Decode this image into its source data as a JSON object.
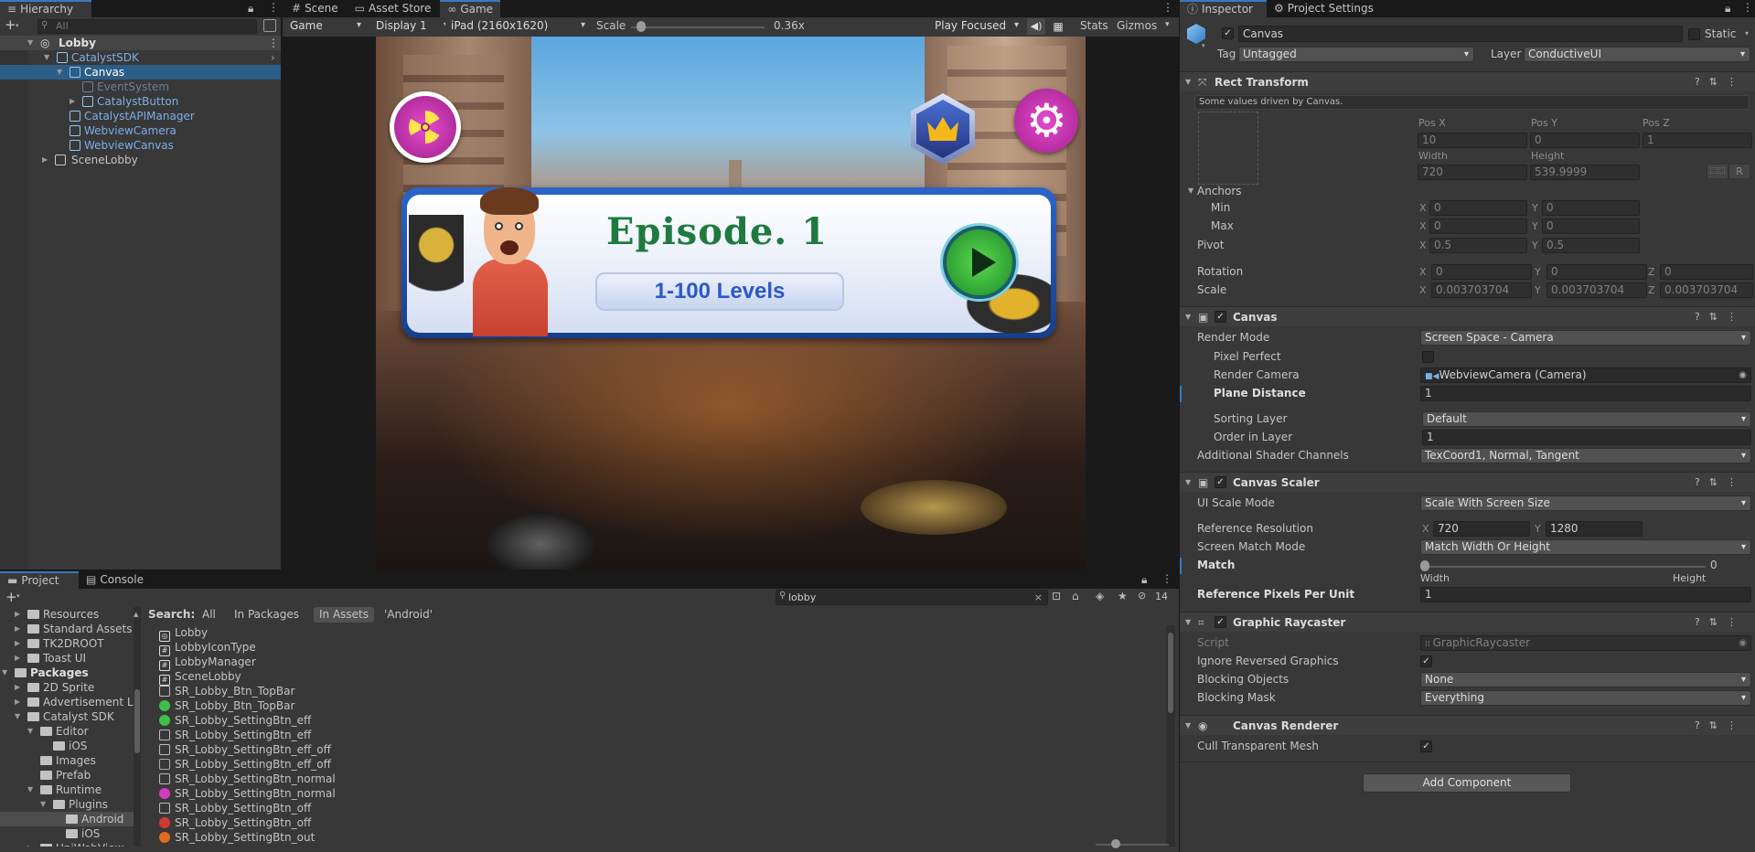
{
  "hierarchy": {
    "tab": "Hierarchy",
    "search_placeholder": "All",
    "items": [
      {
        "label": "Lobby",
        "arrow": "▼"
      },
      {
        "label": "CatalystSDK",
        "arrow": "▼"
      },
      {
        "label": "Canvas",
        "arrow": "▼"
      },
      {
        "label": "EventSystem",
        "arrow": ""
      },
      {
        "label": "CatalystButton",
        "arrow": "▶"
      },
      {
        "label": "CatalystAPIManager",
        "arrow": ""
      },
      {
        "label": "WebviewCamera",
        "arrow": ""
      },
      {
        "label": "WebviewCanvas",
        "arrow": ""
      },
      {
        "label": "SceneLobby",
        "arrow": "▶"
      }
    ]
  },
  "center_tabs": [
    {
      "label": "Scene",
      "icon": "scene-icon"
    },
    {
      "label": "Asset Store",
      "icon": "store-icon"
    },
    {
      "label": "Game",
      "icon": "game-icon"
    }
  ],
  "game_toolbar": {
    "mode": "Game",
    "display": "Display 1",
    "resolution": "iPad (2160x1620)",
    "scale_label": "Scale",
    "scale_value": "0.36x",
    "scale_fraction": 0.04,
    "play_mode": "Play Focused",
    "stats": "Stats",
    "gizmos": "Gizmos"
  },
  "game_view": {
    "episode_title": "Episode. 1",
    "levels_label": "1-100 Levels",
    "colors": {
      "title": "#1e7a3e",
      "levels": "#2b59c7",
      "accent": "#c22aa6"
    }
  },
  "inspector": {
    "tabs": [
      {
        "label": "Inspector"
      },
      {
        "label": "Project Settings"
      }
    ],
    "object_name": "Canvas",
    "static_label": "Static",
    "tag_label": "Tag",
    "tag_value": "Untagged",
    "layer_label": "Layer",
    "layer_value": "ConductiveUI",
    "rect_transform": {
      "title": "Rect Transform",
      "note": "Some values driven by Canvas.",
      "pos_x_label": "Pos X",
      "pos_y_label": "Pos Y",
      "pos_z_label": "Pos Z",
      "pos_x": "10",
      "pos_y": "0",
      "pos_z": "1",
      "width_label": "Width",
      "height_label": "Height",
      "width": "720",
      "height": "539.9999",
      "r_button": "R",
      "anchors_label": "Anchors",
      "min_label": "Min",
      "min_x": "0",
      "min_y": "0",
      "max_label": "Max",
      "max_x": "0",
      "max_y": "0",
      "pivot_label": "Pivot",
      "pivot_x": "0.5",
      "pivot_y": "0.5",
      "rotation_label": "Rotation",
      "rot_x": "0",
      "rot_y": "0",
      "rot_z": "0",
      "scale_label": "Scale",
      "scale_x": "0.003703704",
      "scale_y": "0.003703704",
      "scale_z": "0.003703704"
    },
    "canvas": {
      "title": "Canvas",
      "render_mode_label": "Render Mode",
      "render_mode": "Screen Space - Camera",
      "pixel_perfect_label": "Pixel Perfect",
      "render_camera_label": "Render Camera",
      "render_camera": "WebviewCamera (Camera)",
      "plane_distance_label": "Plane Distance",
      "plane_distance": "1",
      "sorting_layer_label": "Sorting Layer",
      "sorting_layer": "Default",
      "order_label": "Order in Layer",
      "order": "1",
      "shader_label": "Additional Shader Channels",
      "shader": "TexCoord1, Normal, Tangent"
    },
    "canvas_scaler": {
      "title": "Canvas Scaler",
      "ui_scale_label": "UI Scale Mode",
      "ui_scale": "Scale With Screen Size",
      "ref_res_label": "Reference Resolution",
      "ref_x": "720",
      "ref_y": "1280",
      "match_mode_label": "Screen Match Mode",
      "match_mode": "Match Width Or Height",
      "match_label": "Match",
      "match_value": "0",
      "match_fraction": 0,
      "width_label": "Width",
      "height_label": "Height",
      "ppu_label": "Reference Pixels Per Unit",
      "ppu": "1"
    },
    "graphic_raycaster": {
      "title": "Graphic Raycaster",
      "script_label": "Script",
      "script": "GraphicRaycaster",
      "ignore_label": "Ignore Reversed Graphics",
      "blocking_objects_label": "Blocking Objects",
      "blocking_objects": "None",
      "blocking_mask_label": "Blocking Mask",
      "blocking_mask": "Everything"
    },
    "canvas_renderer": {
      "title": "Canvas Renderer",
      "cull_label": "Cull Transparent Mesh"
    },
    "add_component": "Add Component",
    "x": "X",
    "y": "Y",
    "z": "Z"
  },
  "project": {
    "tabs": [
      {
        "label": "Project"
      },
      {
        "label": "Console"
      }
    ],
    "search_value": "lobby",
    "hidden_count": "14",
    "search_label": "Search:",
    "filters": [
      "All",
      "In Packages",
      "In Assets",
      "'Android'"
    ],
    "tree": [
      {
        "label": "Resources",
        "arrow": "▶",
        "bold": false
      },
      {
        "label": "Standard Assets",
        "arrow": "▶",
        "bold": false
      },
      {
        "label": "TK2DROOT",
        "arrow": "▶",
        "bold": false
      },
      {
        "label": "Toast UI",
        "arrow": "▶",
        "bold": false
      },
      {
        "label": "Packages",
        "arrow": "▼",
        "bold": true
      },
      {
        "label": "2D Sprite",
        "arrow": "▶",
        "bold": false
      },
      {
        "label": "Advertisement Le",
        "arrow": "▶",
        "bold": false
      },
      {
        "label": "Catalyst SDK",
        "arrow": "▼",
        "bold": false
      },
      {
        "label": "Editor",
        "arrow": "▼",
        "bold": false
      },
      {
        "label": "iOS",
        "arrow": "",
        "bold": false
      },
      {
        "label": "Images",
        "arrow": "",
        "bold": false
      },
      {
        "label": "Prefab",
        "arrow": "",
        "bold": false
      },
      {
        "label": "Runtime",
        "arrow": "▼",
        "bold": false
      },
      {
        "label": "Plugins",
        "arrow": "▼",
        "bold": false
      },
      {
        "label": "Android",
        "arrow": "",
        "bold": false
      },
      {
        "label": "iOS",
        "arrow": "",
        "bold": false
      },
      {
        "label": "UniWebView",
        "arrow": "▶",
        "bold": false
      }
    ],
    "results": [
      {
        "label": "Lobby",
        "icon": "unity-scene-icon"
      },
      {
        "label": "LobbyIconType",
        "icon": "script-icon"
      },
      {
        "label": "LobbyManager",
        "icon": "script-icon"
      },
      {
        "label": "SceneLobby",
        "icon": "script-icon"
      },
      {
        "label": "SR_Lobby_Btn_TopBar",
        "icon": "sprite-icon"
      },
      {
        "label": "SR_Lobby_Btn_TopBar",
        "icon": "green-sprite-icon"
      },
      {
        "label": "SR_Lobby_SettingBtn_eff",
        "icon": "green-sprite-icon"
      },
      {
        "label": "SR_Lobby_SettingBtn_eff",
        "icon": "sprite-icon"
      },
      {
        "label": "SR_Lobby_SettingBtn_eff_off",
        "icon": "sprite-icon"
      },
      {
        "label": "SR_Lobby_SettingBtn_eff_off",
        "icon": "gear-sprite-icon"
      },
      {
        "label": "SR_Lobby_SettingBtn_normal",
        "icon": "sprite-icon"
      },
      {
        "label": "SR_Lobby_SettingBtn_normal",
        "icon": "pink-sprite-icon"
      },
      {
        "label": "SR_Lobby_SettingBtn_off",
        "icon": "sprite-icon"
      },
      {
        "label": "SR_Lobby_SettingBtn_off",
        "icon": "red-sprite-icon"
      },
      {
        "label": "SR_Lobby_SettingBtn_out",
        "icon": "orange-sprite-icon"
      }
    ]
  }
}
